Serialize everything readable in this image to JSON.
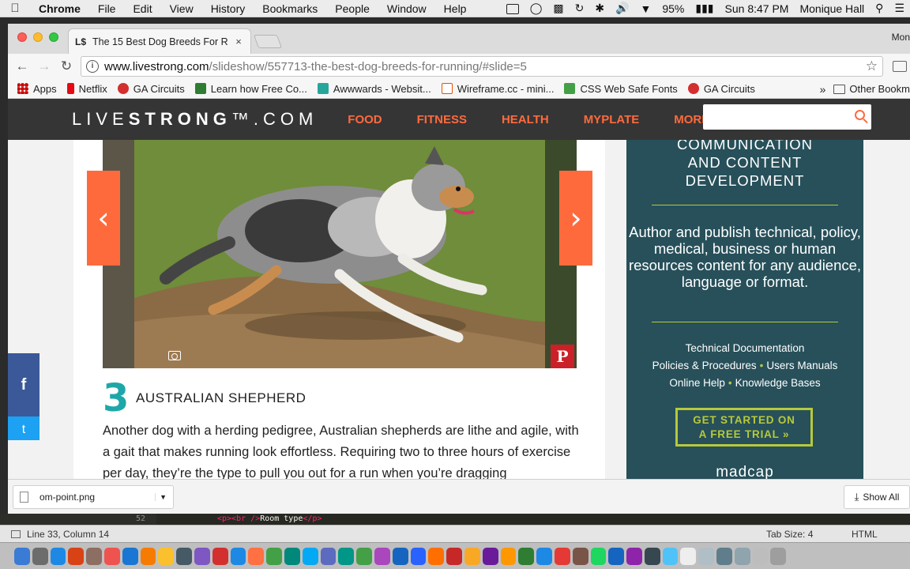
{
  "menubar": {
    "app": "Chrome",
    "items": [
      "File",
      "Edit",
      "View",
      "History",
      "Bookmarks",
      "People",
      "Window",
      "Help"
    ],
    "battery": "95%",
    "clock": "Sun 8:47 PM",
    "user": "Monique Hall"
  },
  "browser": {
    "tab_favicon": "L$",
    "tab_title": "The 15 Best Dog Breeds For R",
    "tab_close": "×",
    "profile": "Mon",
    "url_domain": "www.livestrong.com",
    "url_path": "/slideshow/557713-the-best-dog-breeds-for-running/#slide=5",
    "bookmarks": [
      {
        "label": "Apps",
        "color": "#d93025"
      },
      {
        "label": "Netflix",
        "color": "#e50914"
      },
      {
        "label": "GA Circuits",
        "color": "#d32f2f"
      },
      {
        "label": "Learn how Free Co...",
        "color": "#2e7d32"
      },
      {
        "label": "Awwwards - Websit...",
        "color": "#26a69a"
      },
      {
        "label": "Wireframe.cc - mini...",
        "color": "#e65100"
      },
      {
        "label": "CSS Web Safe Fonts",
        "color": "#43a047"
      },
      {
        "label": "GA Circuits",
        "color": "#d32f2f"
      }
    ],
    "bookmarks_overflow": "»",
    "other_bookmarks": "Other Bookm"
  },
  "site": {
    "logo_light1": "LIVE",
    "logo_bold": "STRONG",
    "logo_light2": "™.COM",
    "nav": [
      "FOOD",
      "FITNESS",
      "HEALTH",
      "MYPLATE",
      "MORE"
    ],
    "accent": "#ff6a3d",
    "prev_arrow": "‹",
    "next_arrow": "›",
    "pinterest": "P",
    "slide_number": "3",
    "slide_title": "AUSTRALIAN SHEPHERD",
    "slide_body": "Another dog with a herding pedigree, Australian shepherds are lithe and agile, with a gait that makes running look effortless. Requiring two to three hours of exercise per day, they’re the type to pull you out for a run when you’re dragging",
    "social_facebook": "f",
    "social_twitter": "t"
  },
  "ad": {
    "headline_1": "COMMUNICATION",
    "headline_2": "AND CONTENT",
    "headline_3": "DEVELOPMENT",
    "body": "Author and publish technical, policy, medical, business or human resources content for any audience, language or format.",
    "service_1": "Technical Documentation",
    "service_2": "Policies & Procedures",
    "service_3": "Users Manuals",
    "service_4": "Online Help",
    "service_5": "Knowledge Bases",
    "separator": "•",
    "cta_line1": "GET STARTED ON",
    "cta_line2": "A FREE TRIAL »",
    "brand": "madcap",
    "accent": "#b7c93a"
  },
  "downloads": {
    "file": "om-point.png",
    "show_all": "Show All"
  },
  "editor": {
    "line_number": "52",
    "code_open": "<p><br />",
    "code_text": "Room type",
    "code_close": "</p>",
    "status_position": "Line 33, Column 14",
    "tab_size": "Tab Size: 4",
    "syntax": "HTML"
  },
  "dock_colors": [
    "#3a7bd5",
    "#6c6c6c",
    "#1e88e5",
    "#d84315",
    "#8d6e63",
    "#ef5350",
    "#1976d2",
    "#f57c00",
    "#fbc02d",
    "#455a64",
    "#7e57c2",
    "#d32f2f",
    "#1e88e5",
    "#ff7043",
    "#43a047",
    "#00897b",
    "#03a9f4",
    "#5c6bc0",
    "#009688",
    "#43a047",
    "#ab47bc",
    "#1565c0",
    "#2962ff",
    "#ff6f00",
    "#c62828",
    "#f9a825",
    "#6a1b9a",
    "#ff9800",
    "#2e7d32",
    "#1e88e5",
    "#e53935",
    "#795548",
    "#1ed760",
    "#1565c0",
    "#8e24aa",
    "#37474f",
    "#4fc3f7",
    "#eeeeee",
    "#b0bec5",
    "#607d8b",
    "#90a4ae",
    "#bdbdbd",
    "#9e9e9e"
  ]
}
